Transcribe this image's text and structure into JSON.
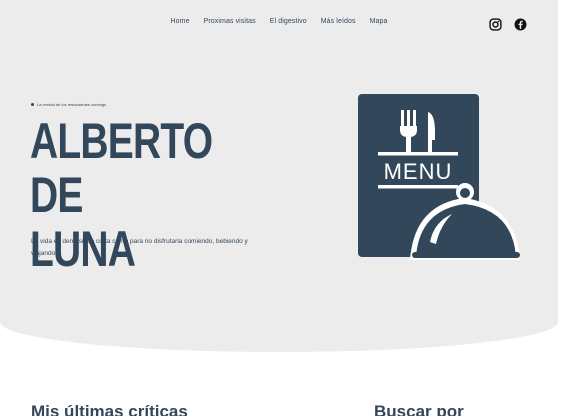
{
  "nav": {
    "items": [
      "Home",
      "Proximas visitas",
      "El digestivo",
      "Más leídos",
      "Mapa"
    ]
  },
  "social": {
    "icons": [
      "instagram-icon",
      "facebook-icon"
    ]
  },
  "hero": {
    "tagline": "La verdad de los restaurantes conmigo",
    "title_line1": "ALBERTO DE",
    "title_line2": "LUNA",
    "description": "La vida es demasiado corta como para no disfrutarla comiendo, bebiendo y viajando.",
    "menu_label": "MENU"
  },
  "sections": {
    "latest_reviews": "Mis últimas críticas",
    "search_by": "Buscar por"
  },
  "colors": {
    "primary": "#33475b",
    "hero_bg": "#ececec"
  }
}
